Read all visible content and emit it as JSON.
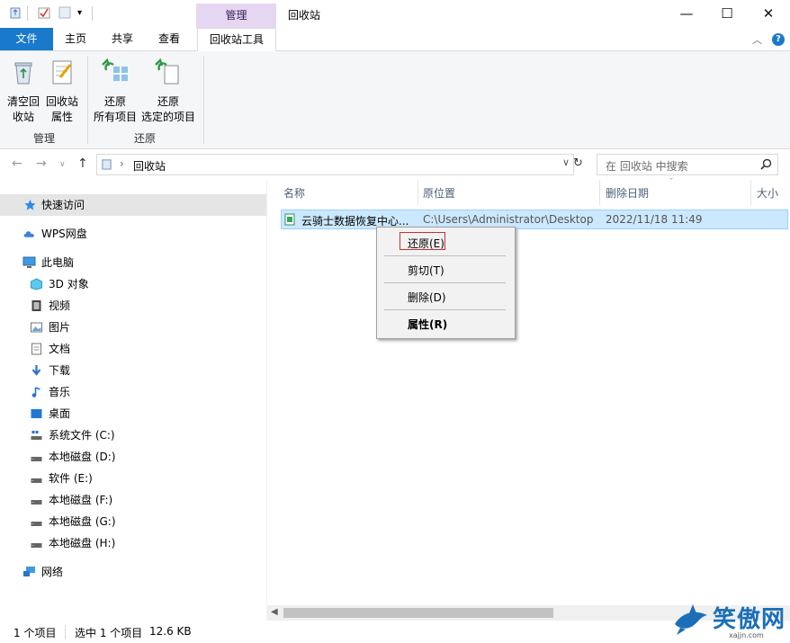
{
  "window": {
    "title": "回收站",
    "context_tab_group": "管理",
    "controls": {
      "minimize": "—",
      "maximize": "☐",
      "close": "✕"
    }
  },
  "ribbon": {
    "tabs": [
      "文件",
      "主页",
      "共享",
      "查看",
      "回收站工具"
    ],
    "groups": [
      {
        "label": "管理",
        "buttons": [
          {
            "line1": "清空回",
            "line2": "收站"
          },
          {
            "line1": "回收站",
            "line2": "属性"
          }
        ]
      },
      {
        "label": "还原",
        "buttons": [
          {
            "line1": "还原",
            "line2": "所有项目"
          },
          {
            "line1": "还原",
            "line2": "选定的项目"
          }
        ]
      }
    ]
  },
  "address": {
    "path": "回收站",
    "search_placeholder": "在 回收站 中搜索"
  },
  "nav": {
    "items": [
      {
        "label": "快速访问",
        "icon": "star-icon"
      },
      {
        "label": "WPS网盘",
        "icon": "cloud-icon"
      },
      {
        "label": "此电脑",
        "icon": "computer-icon"
      },
      {
        "label": "3D 对象",
        "icon": "cube-icon"
      },
      {
        "label": "视频",
        "icon": "video-icon"
      },
      {
        "label": "图片",
        "icon": "picture-icon"
      },
      {
        "label": "文档",
        "icon": "document-icon"
      },
      {
        "label": "下载",
        "icon": "download-icon"
      },
      {
        "label": "音乐",
        "icon": "music-icon"
      },
      {
        "label": "桌面",
        "icon": "desktop-icon"
      },
      {
        "label": "系统文件 (C:)",
        "icon": "system-drive-icon"
      },
      {
        "label": "本地磁盘 (D:)",
        "icon": "drive-icon"
      },
      {
        "label": "软件 (E:)",
        "icon": "drive-icon"
      },
      {
        "label": "本地磁盘 (F:)",
        "icon": "drive-icon"
      },
      {
        "label": "本地磁盘 (G:)",
        "icon": "drive-icon"
      },
      {
        "label": "本地磁盘 (H:)",
        "icon": "drive-icon"
      },
      {
        "label": "网络",
        "icon": "network-icon"
      }
    ]
  },
  "list": {
    "columns": [
      "名称",
      "原位置",
      "删除日期",
      "大小"
    ],
    "rows": [
      {
        "name": "云骑士数据恢复中心...",
        "location": "C:\\Users\\Administrator\\Desktop",
        "deleted": "2022/11/18 11:49"
      }
    ]
  },
  "context_menu": {
    "items": [
      "还原(E)",
      "剪切(T)",
      "删除(D)",
      "属性(R)"
    ]
  },
  "status": {
    "count": "1 个项目",
    "selected": "选中 1 个项目",
    "size": "12.6 KB"
  },
  "watermark": {
    "text": "笑傲网",
    "sub": "xajjn.com"
  },
  "colors": {
    "accent": "#1979ca",
    "context_tab": "#e5d6f1",
    "selection": "#cce8ff"
  }
}
